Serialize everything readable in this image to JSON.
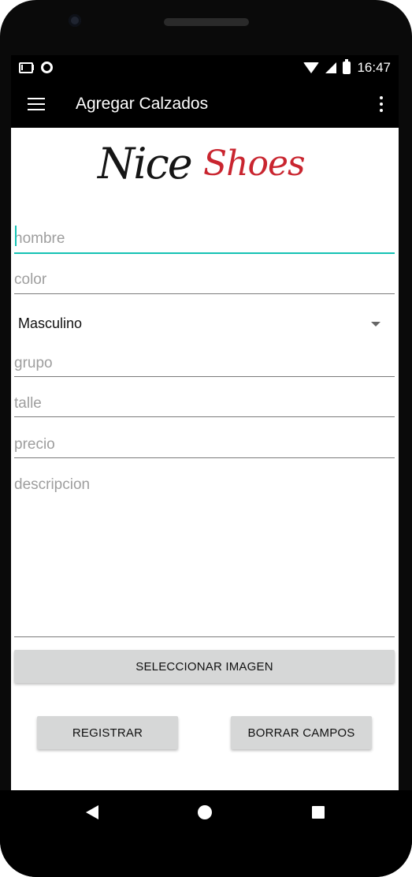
{
  "appbar": {
    "title": "Agregar Calzados"
  },
  "status": {
    "time": "16:47"
  },
  "logo": {
    "word1": "Nice",
    "word2": "Shoes"
  },
  "form": {
    "nombre_placeholder": "nombre",
    "color_placeholder": "color",
    "genero_selected": "Masculino",
    "grupo_placeholder": "grupo",
    "talle_placeholder": "talle",
    "precio_placeholder": "precio",
    "descripcion_placeholder": "descripcion"
  },
  "buttons": {
    "seleccionar": "SELECCIONAR IMAGEN",
    "registrar": "REGISTRAR",
    "borrar": "BORRAR CAMPOS"
  },
  "colors": {
    "accent": "#15c2b4",
    "button_bg": "#d6d7d7",
    "logo_red": "#c9252f"
  }
}
